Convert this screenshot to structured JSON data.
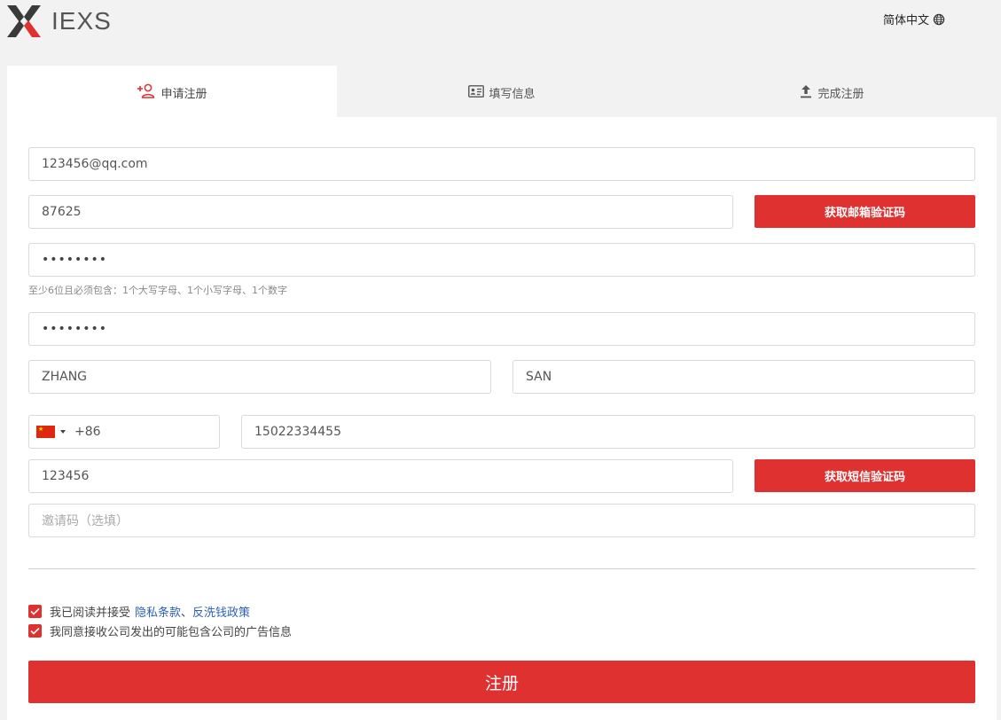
{
  "brand": {
    "name": "IEXS"
  },
  "language": {
    "label": "简体中文"
  },
  "steps": [
    {
      "label": "申请注册",
      "icon": "add-user-icon"
    },
    {
      "label": "填写信息",
      "icon": "id-card-icon"
    },
    {
      "label": "完成注册",
      "icon": "upload-icon"
    }
  ],
  "form": {
    "email": {
      "value": "123456@qq.com"
    },
    "email_code": {
      "value": "87625"
    },
    "email_code_button": "获取邮箱验证码",
    "password": {
      "value": "••••••••"
    },
    "password_hint": "至少6位且必须包含：1个大写字母、1个小写字母、1个数字",
    "confirm_password": {
      "value": "••••••••"
    },
    "last_name": {
      "value": "ZHANG"
    },
    "first_name": {
      "value": "SAN"
    },
    "country_code": {
      "value": "+86"
    },
    "phone": {
      "value": "15022334455"
    },
    "sms_code": {
      "value": "123456"
    },
    "sms_code_button": "获取短信验证码",
    "invite_code": {
      "placeholder": "邀请码（选填）"
    }
  },
  "agreements": {
    "privacy_prefix": "我已阅读并接受",
    "privacy_link": "隐私条款",
    "separator": "、",
    "aml_link": "反洗钱政策",
    "ads": "我同意接收公司发出的可能包含公司的广告信息"
  },
  "submit_label": "注册",
  "colors": {
    "accent": "#e03131",
    "link": "#2c5fb8"
  }
}
